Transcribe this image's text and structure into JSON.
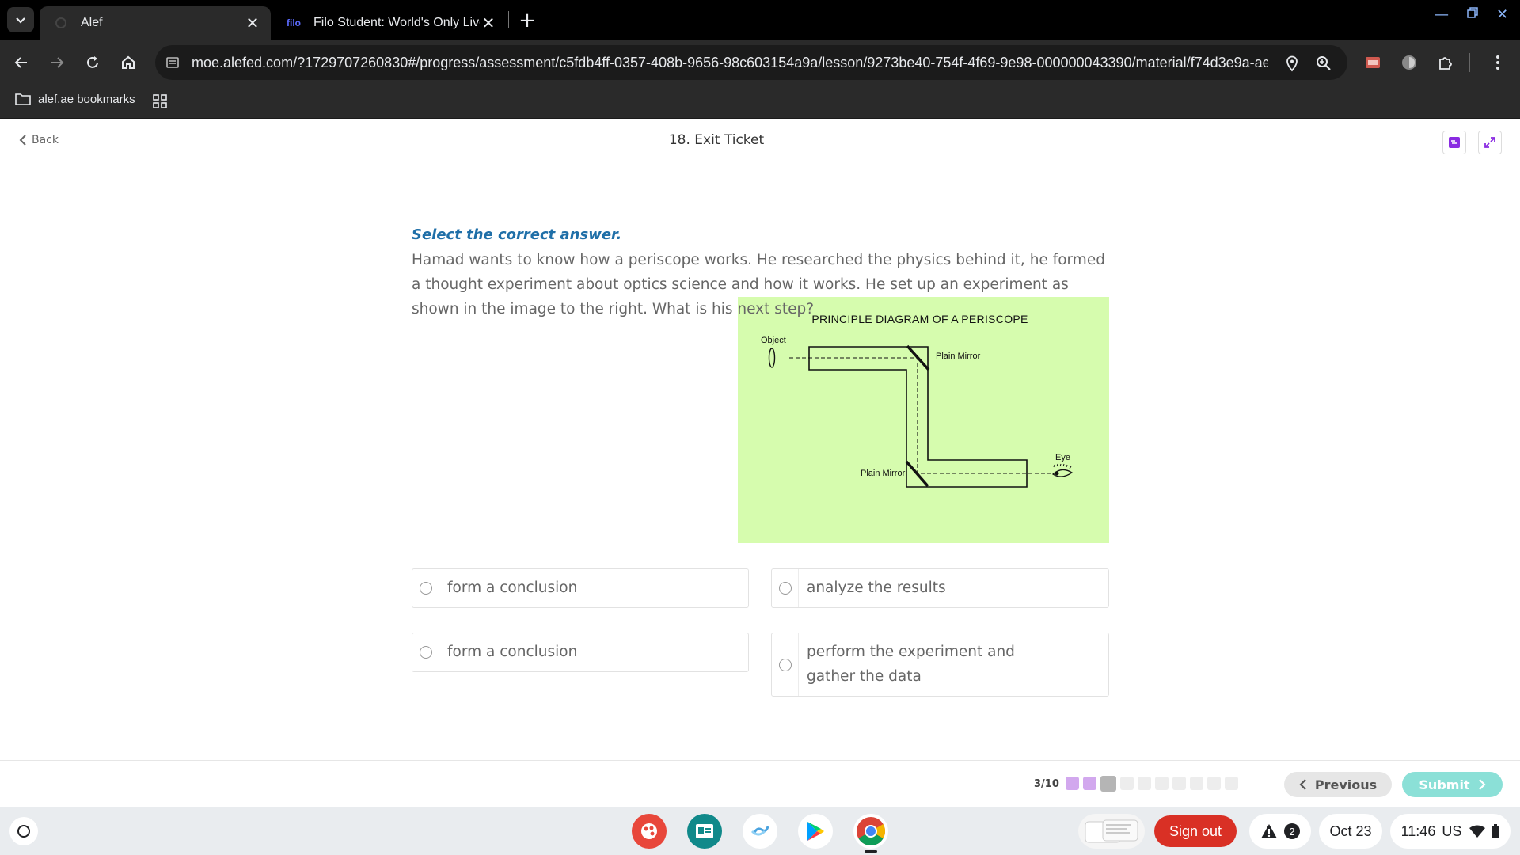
{
  "browser": {
    "tabs": [
      {
        "title": "Alef",
        "active": true
      },
      {
        "favicon_text": "filo",
        "title": "Filo Student: World's Only Live I",
        "active": false
      }
    ],
    "url": "moe.alefed.com/?1729707260830#/progress/assessment/c5fdb4ff-0357-408b-9656-98c603154a9a/lesson/9273be40-754f-4f69-9e98-000000043390/material/f74d3e9a-ae...",
    "bookmarks": [
      {
        "label": "alef.ae bookmarks"
      }
    ]
  },
  "header": {
    "back_label": "Back",
    "title": "18. Exit Ticket"
  },
  "question": {
    "instruction": "Select the correct answer.",
    "text": "Hamad wants to know how a periscope works. He researched the physics behind it, he formed a thought experiment about optics science and how it works. He set up an experiment as shown in the image to the right. What is his next step?",
    "diagram": {
      "title": "PRINCIPLE DIAGRAM OF A PERISCOPE",
      "object_label": "Object",
      "top_mirror_label": "Plain Mirror",
      "bottom_mirror_label": "Plain Mirror",
      "eye_label": "Eye",
      "background_color": "#d6fcae"
    },
    "options": [
      {
        "label": "form a conclusion"
      },
      {
        "label": "analyze the results"
      },
      {
        "label": "form a conclusion"
      },
      {
        "label": "perform the experiment and gather the data"
      }
    ]
  },
  "footer": {
    "progress_text": "3/10",
    "progress": {
      "answered": 2,
      "current": 3,
      "total": 10
    },
    "previous_label": "Previous",
    "submit_label": "Submit"
  },
  "shelf": {
    "sign_out_label": "Sign out",
    "notification_count": "2",
    "date": "Oct 23",
    "time": "11:46",
    "locale": "US"
  },
  "colors": {
    "instruction": "#1f6fa8",
    "submit": "#8be0d7",
    "progress_done": "#d2a8ee",
    "sign_out": "#d93025"
  }
}
